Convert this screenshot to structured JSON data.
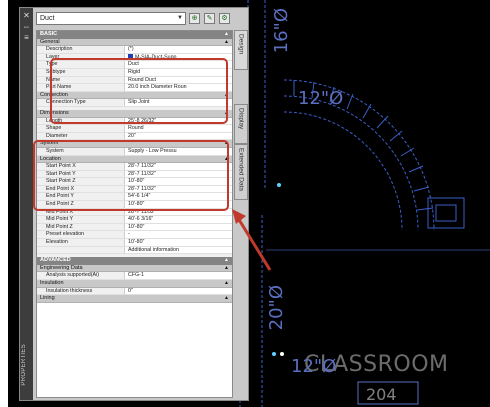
{
  "palette": {
    "style_select": "Duct",
    "tabs": [
      "Design",
      "Display",
      "Extended Data"
    ],
    "vertical_title": "PROPERTIES"
  },
  "canvas": {
    "labels": {
      "top_dim": "16\"Ø",
      "mid_dim": "12\"Ø",
      "low_dim": "20\"Ø",
      "bottom_dim": "12\"Ø",
      "room": "CLASSROOM",
      "room_no": "204"
    },
    "colors": {
      "duct": "#3a5fc8",
      "text": "#5a6fbf",
      "highlight": "#c0392b"
    }
  },
  "sections": [
    {
      "kind": "cat",
      "label": "BASIC"
    },
    {
      "kind": "sub",
      "label": "General"
    },
    {
      "kind": "row",
      "label": "Description",
      "value": "(*)"
    },
    {
      "kind": "row",
      "label": "Layer",
      "value": "M-SIA-Duct-Supp",
      "swatch": true
    },
    {
      "kind": "row",
      "label": "Type",
      "value": "Duct"
    },
    {
      "kind": "row",
      "label": "Subtype",
      "value": "Rigid"
    },
    {
      "kind": "row",
      "label": "Name",
      "value": "Round Duct"
    },
    {
      "kind": "row",
      "label": "Part Name",
      "value": "20.0 inch Diameter Roun"
    },
    {
      "kind": "sub",
      "label": "Connection"
    },
    {
      "kind": "row",
      "label": "Connection Type",
      "value": "Slip Joint"
    },
    {
      "kind": "spacer"
    },
    {
      "kind": "sub",
      "label": "Dimensions"
    },
    {
      "kind": "row",
      "label": "Length",
      "value": "25'-8 26/32\""
    },
    {
      "kind": "row",
      "label": "Shape",
      "value": "Round"
    },
    {
      "kind": "row",
      "label": "Diameter",
      "value": "20\""
    },
    {
      "kind": "sub",
      "label": "System"
    },
    {
      "kind": "row",
      "label": "System",
      "value": "Supply - Low Pressu"
    },
    {
      "kind": "sub",
      "label": "Location"
    },
    {
      "kind": "row",
      "label": "Start Point X",
      "value": "28'-7 11/32\""
    },
    {
      "kind": "row",
      "label": "Start Point Y",
      "value": "28'-7 11/32\""
    },
    {
      "kind": "row",
      "label": "Start Point Z",
      "value": "10'-80\""
    },
    {
      "kind": "row",
      "label": "End Point X",
      "value": "28'-7 11/32\""
    },
    {
      "kind": "row",
      "label": "End Point Y",
      "value": "54'-6 1/4\""
    },
    {
      "kind": "row",
      "label": "End Point Z",
      "value": "10'-80\""
    },
    {
      "kind": "row",
      "label": "Mid Point X",
      "value": "28'-7 11/32\""
    },
    {
      "kind": "row",
      "label": "Mid Point Y",
      "value": "40'-6 3/16\""
    },
    {
      "kind": "row",
      "label": "Mid Point Z",
      "value": "10'-80\""
    },
    {
      "kind": "row",
      "label": "Preset elevation",
      "value": "-"
    },
    {
      "kind": "row",
      "label": "Elevation",
      "value": "10'-80\""
    },
    {
      "kind": "row",
      "label": "",
      "value": "Additional information"
    },
    {
      "kind": "spacer"
    },
    {
      "kind": "cat",
      "label": "ADVANCED"
    },
    {
      "kind": "sub",
      "label": "Engineering Data"
    },
    {
      "kind": "row",
      "label": "Analysis supported(Ai)",
      "value": "CFG-1"
    },
    {
      "kind": "sub",
      "label": "Insulation"
    },
    {
      "kind": "row",
      "label": "Insulation thickness",
      "value": "0\""
    },
    {
      "kind": "sub",
      "label": "Lining"
    }
  ]
}
